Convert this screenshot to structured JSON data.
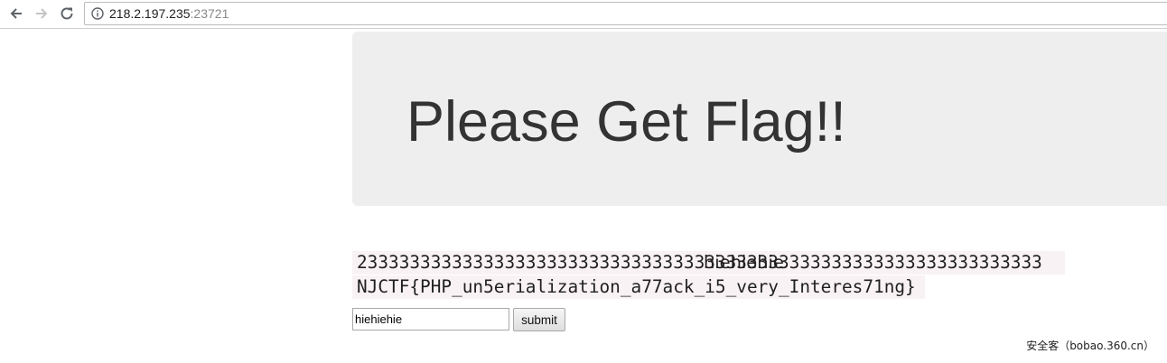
{
  "browser": {
    "url_host": "218.2.197.235",
    "url_port": ":23721",
    "back_icon": "back-arrow-icon",
    "forward_icon": "forward-arrow-icon",
    "reload_icon": "reload-icon",
    "info_icon": "info-icon"
  },
  "page": {
    "title": "Please Get Flag!!",
    "output_line1": "23333333333333333333333333333333333333333333333333333333333333333",
    "output_overlay": "hiehiehie",
    "output_line2": "NJCTF{PHP_un5erialization_a77ack_i5_very_Interes71ng}",
    "input_value": "hiehiehie",
    "submit_label": "submit"
  },
  "watermark": "安全客（bobao.360.cn）",
  "colors": {
    "jumbotron_bg": "#eeeeee",
    "code_bg": "#f9f2f4",
    "title_text": "#333333"
  }
}
